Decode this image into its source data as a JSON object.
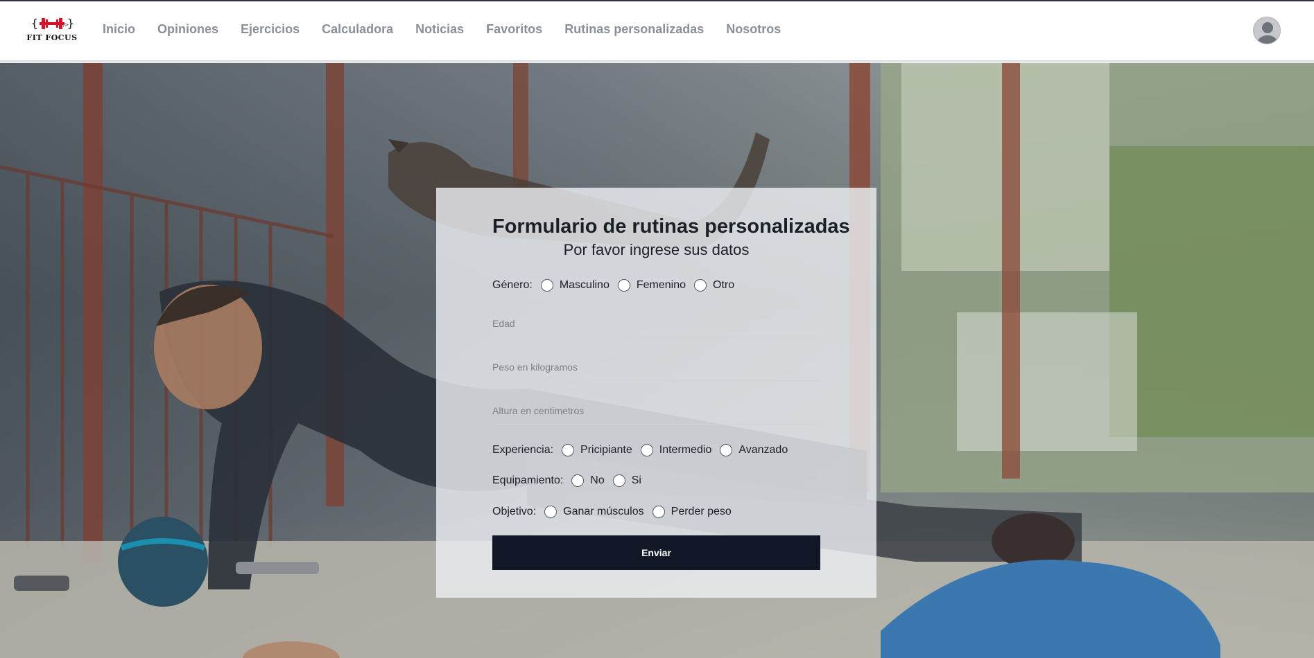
{
  "navbar": {
    "logo_text": "FIT FOCUS",
    "links": [
      "Inicio",
      "Opiniones",
      "Ejercicios",
      "Calculadora",
      "Noticias",
      "Favoritos",
      "Rutinas personalizadas",
      "Nosotros"
    ]
  },
  "form": {
    "title": "Formulario de rutinas personalizadas",
    "subtitle": "Por favor ingrese sus datos",
    "gender": {
      "label": "Género:",
      "options": [
        "Masculino",
        "Femenino",
        "Otro"
      ]
    },
    "age_placeholder": "Edad",
    "weight_placeholder": "Peso en kilogramos",
    "height_placeholder": "Altura en centimetros",
    "experience": {
      "label": "Experiencia:",
      "options": [
        "Pricipiante",
        "Intermedio",
        "Avanzado"
      ]
    },
    "equipment": {
      "label": "Equipamiento:",
      "options": [
        "No",
        "Si"
      ]
    },
    "goal": {
      "label": "Objetivo:",
      "options": [
        "Ganar músculos",
        "Perder peso"
      ]
    },
    "submit_label": "Enviar"
  },
  "colors": {
    "brand_red": "#d3152b",
    "nav_text": "#8a8f99",
    "button_bg": "#121727"
  },
  "icons": [
    "dumbbell-logo-icon",
    "user-avatar-icon"
  ]
}
